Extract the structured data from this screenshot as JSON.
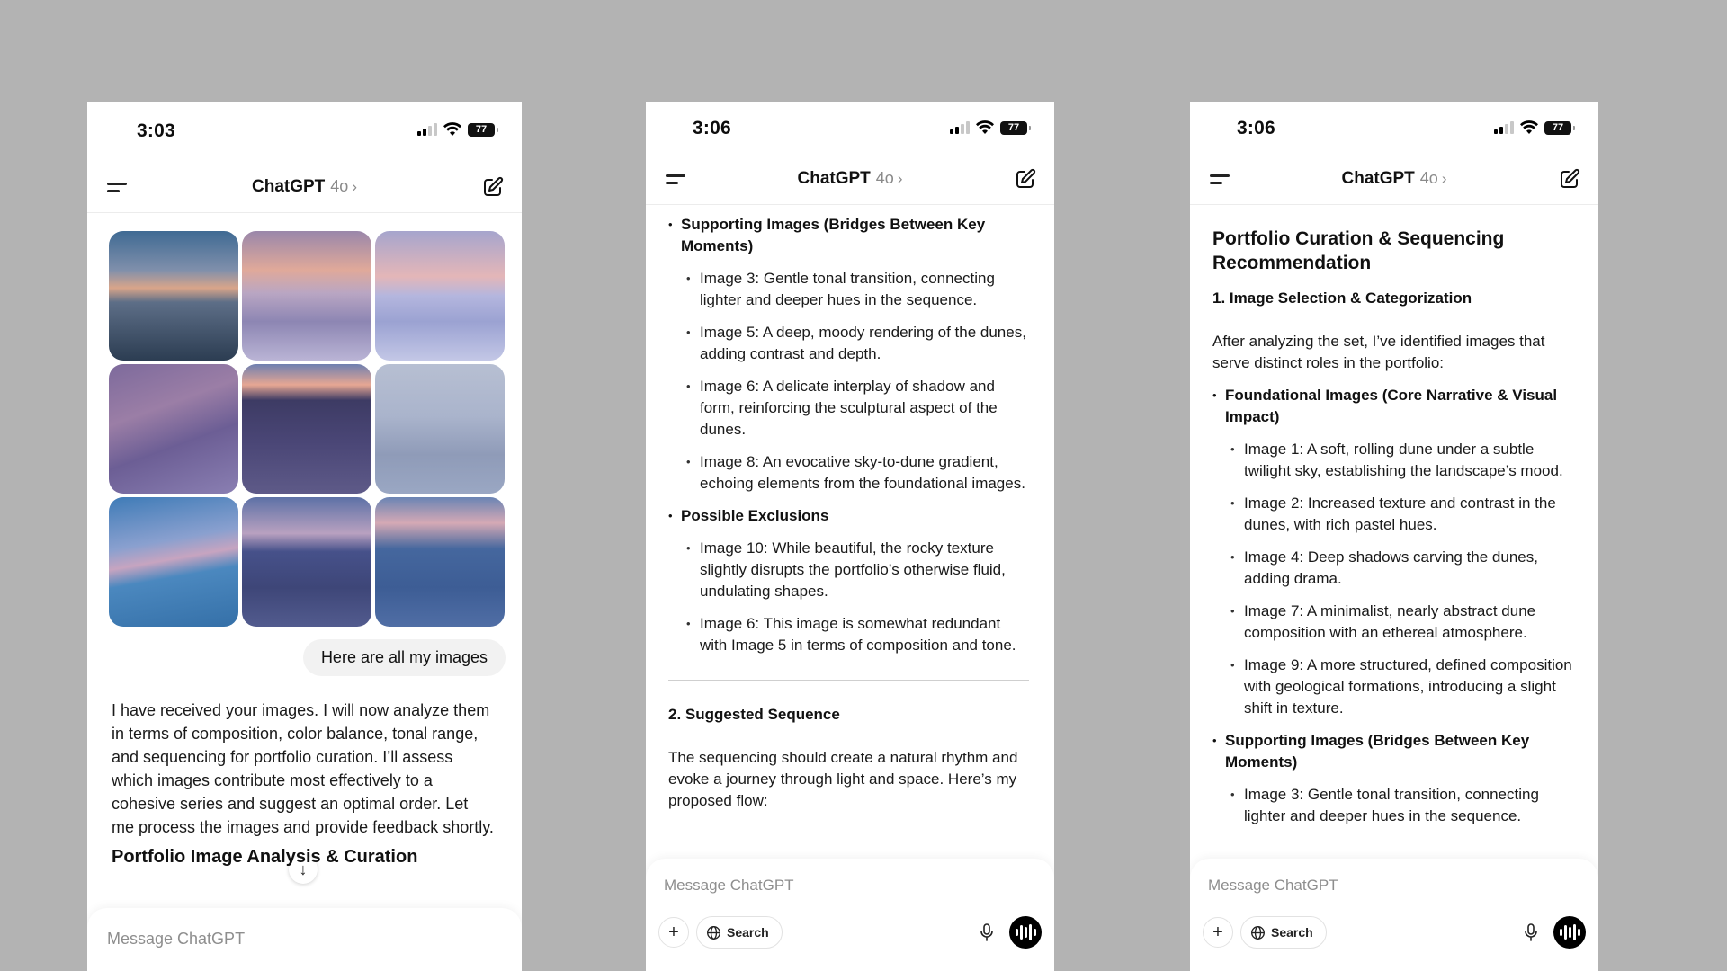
{
  "phones": [
    {
      "status": {
        "time": "3:03",
        "battery": "77"
      },
      "nav": {
        "title": "ChatGPT",
        "model": "4o",
        "chevron": "›"
      },
      "images": [
        {
          "label": "Image 1"
        },
        {
          "label": "Image 2"
        },
        {
          "label": "Image 3"
        },
        {
          "label": "Image 4"
        },
        {
          "label": "Image 5"
        },
        {
          "label": "Image 6"
        },
        {
          "label": "Image 7"
        },
        {
          "label": "Image 8"
        },
        {
          "label": "Image 9"
        }
      ],
      "user_message": "Here are all my images",
      "assistant_message": "I have received your images. I will now analyze them in terms of composition, color balance, tonal range, and sequencing for portfolio curation. I’ll assess which images contribute most effectively to a cohesive series and suggest an optimal order. Let me process the images and provide feedback shortly.",
      "assistant_heading": "Portfolio Image Analysis & Curation",
      "scroll_down": "↓",
      "composer": {
        "placeholder": "Message ChatGPT"
      }
    },
    {
      "status": {
        "time": "3:06",
        "battery": "77"
      },
      "nav": {
        "title": "ChatGPT",
        "model": "4o",
        "chevron": "›"
      },
      "doc": {
        "supporting": {
          "heading": "Supporting Images (Bridges Between Key Moments)",
          "items": [
            "Image 3: Gentle tonal transition, connecting lighter and deeper hues in the sequence.",
            "Image 5: A deep, moody rendering of the dunes, adding contrast and depth.",
            "Image 6: A delicate interplay of shadow and form, reinforcing the sculptural aspect of the dunes.",
            "Image 8: An evocative sky-to-dune gradient, echoing elements from the foundational images."
          ]
        },
        "exclusions": {
          "heading": "Possible Exclusions",
          "items": [
            "Image 10: While beautiful, the rocky texture slightly disrupts the portfolio’s otherwise fluid, undulating shapes.",
            "Image 6: This image is somewhat redundant with Image 5 in terms of composition and tone."
          ]
        },
        "sequence_heading": "2. Suggested Sequence",
        "sequence_text": "The sequencing should create a natural rhythm and evoke a journey through light and space. Here’s my proposed flow:"
      },
      "scroll_down": "↓",
      "composer": {
        "placeholder": "Message ChatGPT",
        "plus": "+",
        "search": "Search"
      }
    },
    {
      "status": {
        "time": "3:06",
        "battery": "77"
      },
      "nav": {
        "title": "ChatGPT",
        "model": "4o",
        "chevron": "›"
      },
      "doc": {
        "title": "Portfolio Curation & Sequencing Recommendation",
        "section1": "1. Image Selection & Categorization",
        "intro": "After analyzing the set, I’ve identified images that serve distinct roles in the portfolio:",
        "foundational": {
          "heading": "Foundational Images (Core Narrative & Visual Impact)",
          "items": [
            "Image 1: A soft, rolling dune under a subtle twilight sky, establishing the landscape’s mood.",
            "Image 2: Increased texture and contrast in the dunes, with rich pastel hues.",
            "Image 4: Deep shadows carving the dunes, adding drama.",
            "Image 7: A minimalist, nearly abstract dune composition with an ethereal atmosphere.",
            "Image 9: A more structured, defined composition with geological formations, introducing a slight shift in texture."
          ]
        },
        "supporting": {
          "heading": "Supporting Images (Bridges Between Key Moments)",
          "items": [
            "Image 3: Gentle tonal transition, connecting lighter and deeper hues in the sequence."
          ]
        }
      },
      "scroll_down": "↓",
      "composer": {
        "placeholder": "Message ChatGPT",
        "plus": "+",
        "search": "Search"
      }
    }
  ]
}
